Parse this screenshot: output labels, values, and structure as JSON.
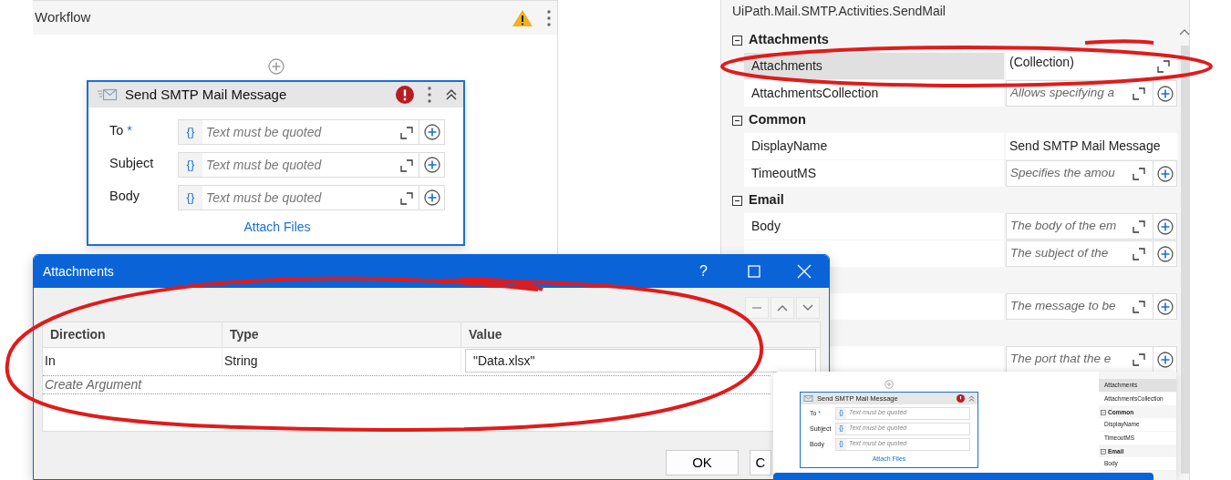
{
  "workflow": {
    "title": "Workflow",
    "warning": true,
    "activity": {
      "title": "Send SMTP Mail Message",
      "error": true,
      "fields": [
        {
          "label": "To",
          "marker": "*",
          "prefix": "{}",
          "placeholder": "Text must be quoted"
        },
        {
          "label": "Subject",
          "prefix": "{}",
          "placeholder": "Text must be quoted"
        },
        {
          "label": "Body",
          "prefix": "{}",
          "placeholder": "Text must be quoted"
        }
      ],
      "link": "Attach Files"
    }
  },
  "properties": {
    "title": "UiPath.Mail.SMTP.Activities.SendMail",
    "sections": [
      {
        "name": "Attachments",
        "expanded": true,
        "rows": [
          {
            "label": "Attachments",
            "selected": true,
            "kind": "collection",
            "value": "(Collection)"
          },
          {
            "label": "AttachmentsCollection",
            "selected": false,
            "kind": "input",
            "placeholder": "Allows specifying a"
          }
        ]
      },
      {
        "name": "Common",
        "expanded": true,
        "rows": [
          {
            "label": "DisplayName",
            "selected": false,
            "kind": "text",
            "value": "Send SMTP Mail Message"
          },
          {
            "label": "TimeoutMS",
            "selected": false,
            "kind": "input",
            "placeholder": "Specifies the amou"
          }
        ]
      },
      {
        "name": "Email",
        "expanded": true,
        "rows": [
          {
            "label": "Body",
            "selected": false,
            "kind": "input",
            "placeholder": "The body of the em"
          },
          {
            "selected": false,
            "kind": "input",
            "placeholder": "The subject of the"
          }
        ]
      },
      {
        "rows": [
          {
            "selected": false,
            "kind": "input",
            "placeholder": "The message to be"
          }
        ]
      },
      {
        "rows": [
          {
            "selected": false,
            "kind": "input",
            "placeholder": "The port that the e"
          }
        ]
      }
    ]
  },
  "dialog": {
    "title": "Attachments",
    "help": "?",
    "columns": [
      "Direction",
      "Type",
      "Value"
    ],
    "rows": [
      {
        "direction": "In",
        "type": "String",
        "value": "\"Data.xlsx\""
      }
    ],
    "create": "Create Argument",
    "buttons": [
      "OK",
      "C"
    ]
  },
  "preview": {
    "activity": {
      "title": "Send SMTP Mail Message",
      "error": true,
      "fields": [
        {
          "label": "To",
          "marker": "*",
          "prefix": "{}",
          "placeholder": "Text must be quoted"
        },
        {
          "label": "Subject",
          "prefix": "{}",
          "placeholder": "Text must be quoted"
        },
        {
          "label": "Body",
          "prefix": "{}",
          "placeholder": "Text must be quoted"
        }
      ],
      "link": "Attach Files"
    },
    "items": [
      {
        "kind": "row",
        "text": "Attachments",
        "selected": true
      },
      {
        "kind": "row",
        "text": "AttachmentsCollection",
        "selected": false
      },
      {
        "kind": "section",
        "text": "Common"
      },
      {
        "kind": "row",
        "text": "DisplayName",
        "selected": false
      },
      {
        "kind": "row",
        "text": "TimeoutMS",
        "selected": false
      },
      {
        "kind": "section",
        "text": "Email"
      },
      {
        "kind": "row",
        "text": "Body",
        "selected": false
      }
    ]
  }
}
